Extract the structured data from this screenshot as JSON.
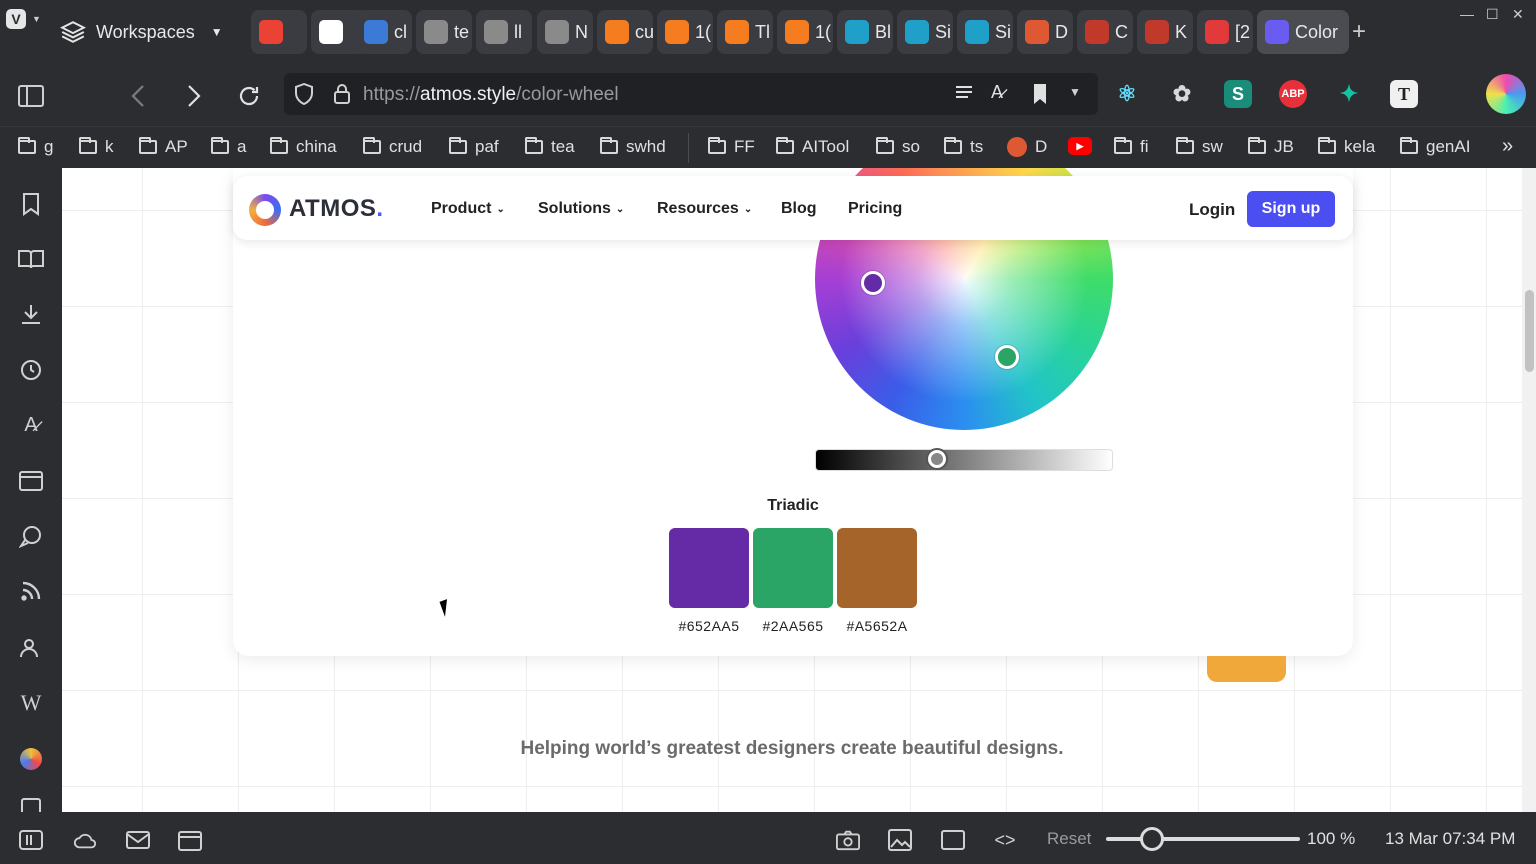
{
  "browser": {
    "workspaces_label": "Workspaces",
    "tabs": [
      {
        "label": "",
        "favicon": "gmail-icon",
        "color": "#ea4335"
      },
      {
        "label": "",
        "favicon": "github-icon",
        "color": "#ffffff"
      },
      {
        "label": "cl",
        "favicon": "chart-icon",
        "color": "#3b7bd6"
      },
      {
        "label": "te",
        "favicon": "globe-icon",
        "color": "#8a8a8a"
      },
      {
        "label": "ll",
        "favicon": "globe-icon",
        "color": "#8a8a8a"
      },
      {
        "label": "N",
        "favicon": "globe-icon",
        "color": "#8a8a8a"
      },
      {
        "label": "cu",
        "favicon": "temu-icon",
        "color": "#f57c1f"
      },
      {
        "label": "1(",
        "favicon": "temu-icon",
        "color": "#f57c1f"
      },
      {
        "label": "Tl",
        "favicon": "temu-icon",
        "color": "#f57c1f"
      },
      {
        "label": "1(",
        "favicon": "temu-icon",
        "color": "#f57c1f"
      },
      {
        "label": "Bl",
        "favicon": "z-icon",
        "color": "#1fa0c9"
      },
      {
        "label": "Si",
        "favicon": "z-icon",
        "color": "#1fa0c9"
      },
      {
        "label": "Si",
        "favicon": "z-icon",
        "color": "#1fa0c9"
      },
      {
        "label": "D",
        "favicon": "duckduckgo-icon",
        "color": "#de5833"
      },
      {
        "label": "C",
        "favicon": "pirate-icon",
        "color": "#c0392b"
      },
      {
        "label": "K",
        "favicon": "pirate-icon",
        "color": "#c0392b"
      },
      {
        "label": "[2",
        "favicon": "audio-icon",
        "color": "#e23a3a"
      },
      {
        "label": "Color",
        "favicon": "atmos-icon",
        "color": "#6a5cf0"
      }
    ],
    "url_prefix": "https://",
    "url_host": "atmos.style",
    "url_path": "/color-wheel",
    "bookmarks_left": [
      "g",
      "k",
      "AP",
      "a",
      "china",
      "crud",
      "paf",
      "tea",
      "swhd"
    ],
    "bookmarks_right": [
      "FF",
      "AITool",
      "so",
      "ts",
      "D",
      "",
      "fi",
      "sw",
      "JB",
      "kela",
      "genAI"
    ],
    "status": {
      "reset_label": "Reset",
      "zoom": "100 %",
      "zoom_level": 0.2,
      "clock": "13 Mar 07:34 PM"
    }
  },
  "site": {
    "brand": "ATMOS",
    "brand_dot": ".",
    "nav": [
      "Product",
      "Solutions",
      "Resources",
      "Blog",
      "Pricing"
    ],
    "login": "Login",
    "signup": "Sign up",
    "harmony_title": "Triadic",
    "swatches": [
      {
        "hex": "#652AA5",
        "color": "#652AA5"
      },
      {
        "hex": "#2AA565",
        "color": "#2AA565"
      },
      {
        "hex": "#A5652A",
        "color": "#A5652A"
      }
    ],
    "brightness_level": 0.4,
    "tagline": "Helping world’s greatest designers create beautiful designs."
  }
}
